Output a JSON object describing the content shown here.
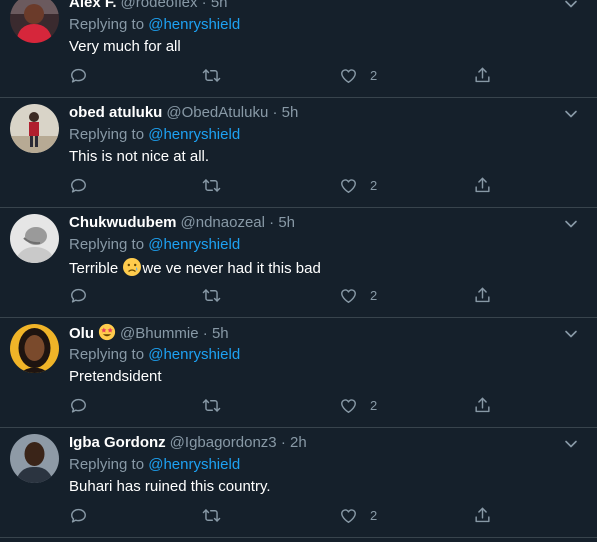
{
  "replying_prefix": "Replying to",
  "tweets": [
    {
      "name": "Alex F.",
      "handle": "@rodeoflex",
      "sep": "·",
      "time": "5h",
      "mention": "@henryshield",
      "text": "Very much for all",
      "likes": "2",
      "avatar_icon": "avatar-child-red-shirt"
    },
    {
      "name": "obed atuluku",
      "handle": "@ObedAtuluku",
      "sep": "·",
      "time": "5h",
      "mention": "@henryshield",
      "text": "This is not nice at all.",
      "likes": "2",
      "avatar_icon": "avatar-person-indoor"
    },
    {
      "name": "Chukwudubem",
      "handle": "@ndnaozeal",
      "sep": "·",
      "time": "5h",
      "mention": "@henryshield",
      "text_before": "Terrible ",
      "text_emoji": "crying-face-emoji",
      "text_after": "we ve never had it this bad",
      "likes": "2",
      "avatar_icon": "avatar-gray-photo"
    },
    {
      "name": "Olu",
      "name_emoji": "star-struck-emoji",
      "handle": "@Bhummie",
      "sep": "·",
      "time": "5h",
      "mention": "@henryshield",
      "text": "Pretendsident",
      "likes": "2",
      "avatar_icon": "avatar-woman-portrait"
    },
    {
      "name": "Igba Gordonz",
      "handle": "@Igbagordonz3",
      "sep": "·",
      "time": "2h",
      "mention": "@henryshield",
      "text": "Buhari has ruined this country.",
      "likes": "2",
      "avatar_icon": "avatar-man-portrait"
    }
  ],
  "colors": {
    "background": "#15202b",
    "muted": "#8899a6",
    "link": "#1da1f2",
    "divider": "#38444d"
  }
}
